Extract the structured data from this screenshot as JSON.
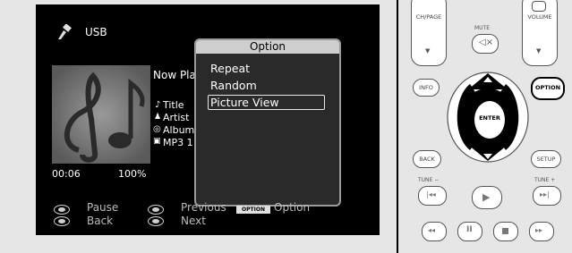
{
  "screen": {
    "source_label": "USB",
    "now_playing": "Now Pla",
    "track": {
      "title": "Title",
      "artist": "Artist",
      "album": "Album",
      "format": "MP3 1"
    },
    "elapsed": "00:06",
    "progress_percent": "100%",
    "popup": {
      "title": "Option",
      "items": [
        "Repeat",
        "Random",
        "Picture View"
      ],
      "selected_index": 2
    },
    "legend": {
      "pause": "Pause",
      "back": "Back",
      "previous": "Previous",
      "next": "Next",
      "option_badge": "OPTION",
      "option": "Option"
    }
  },
  "remote": {
    "ch_page": "CH/PAGE",
    "mute": "MUTE",
    "volume": "VOLUME",
    "info": "INFO",
    "option": "OPTION",
    "enter": "ENTER",
    "back": "BACK",
    "setup": "SETUP",
    "tune_minus": "TUNE −",
    "tune_plus": "TUNE +",
    "highlighted_button": "OPTION",
    "highlight_color": "#000000"
  }
}
